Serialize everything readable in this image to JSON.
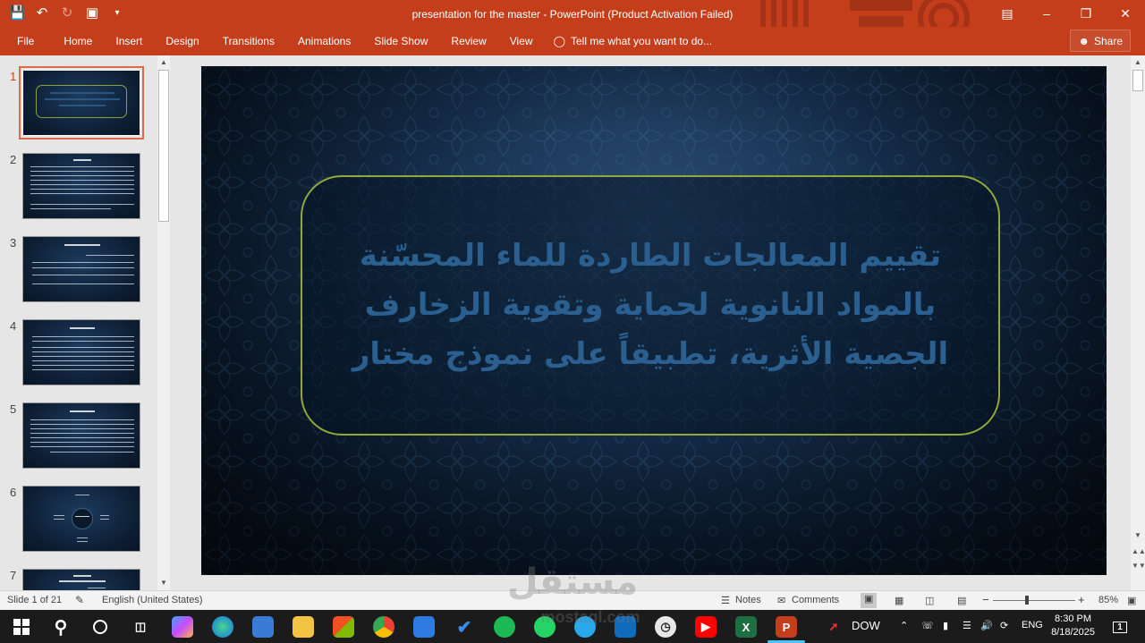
{
  "window": {
    "title": "presentation for the master - PowerPoint (Product Activation Failed)"
  },
  "ribbon": {
    "tabs": [
      "File",
      "Home",
      "Insert",
      "Design",
      "Transitions",
      "Animations",
      "Slide Show",
      "Review",
      "View"
    ],
    "tell_me": "Tell me what you want to do...",
    "share": "Share"
  },
  "thumbnails": {
    "numbers": [
      "1",
      "2",
      "3",
      "4",
      "5",
      "6",
      "7"
    ],
    "active_index": 1
  },
  "slide": {
    "title": "تقييم المعالجات الطاردة للماء المحسّنة بالمواد النانوية لحماية وتقوية الزخارف الجصية الأثرية، تطبيقاً على نموذج مختار"
  },
  "status": {
    "slide_count": "Slide 1 of 21",
    "language": "English (United States)",
    "notes": "Notes",
    "comments": "Comments",
    "zoom": "85%"
  },
  "taskbar": {
    "excel_label": "X",
    "powerpoint_label": "P",
    "dow_label": "DOW",
    "language": "ENG",
    "time": "8:30 PM",
    "date": "8/18/2025",
    "notification_count": "1"
  },
  "watermark": {
    "arabic": "مستقل",
    "latin": "mostaql.com"
  },
  "colors": {
    "accent": "#c43e1c",
    "slide_frame": "#92a83a",
    "slide_title": "#2b5f8f"
  }
}
